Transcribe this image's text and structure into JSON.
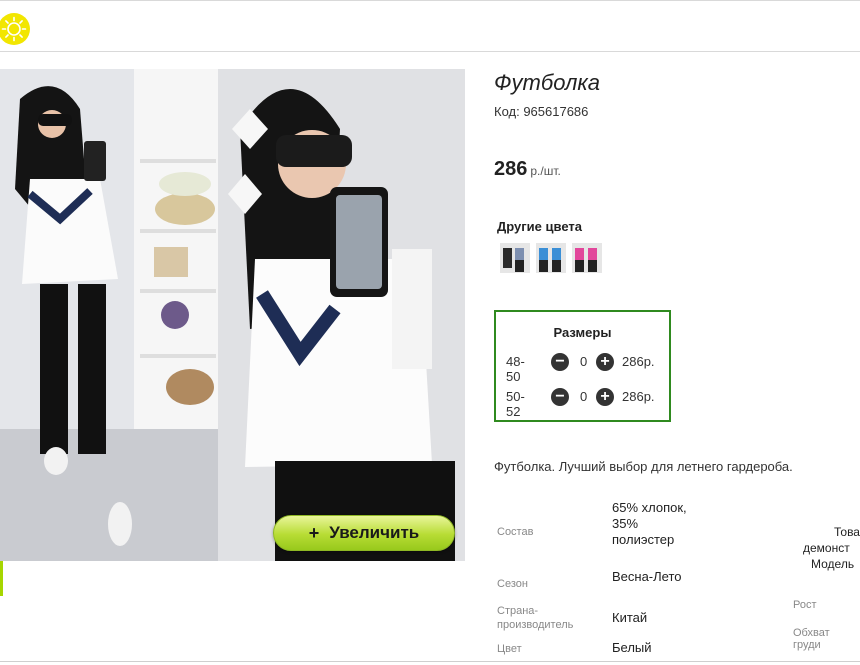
{
  "product": {
    "title": "Футболка",
    "code": "Код: 965617686",
    "price_value": "286",
    "price_unit": "р./шт.",
    "zoom_label": "Увеличить",
    "zoom_plus": "+",
    "other_colors_title": "Другие цвета",
    "sizes_title": "Размеры",
    "sizes": [
      {
        "label": "48-50",
        "qty": "0",
        "price": "286р."
      },
      {
        "label": "50-52",
        "qty": "0",
        "price": "286р."
      }
    ],
    "description": "Футболка. Лучший выбор для летнего гардероба.",
    "specs": [
      {
        "key": "Состав",
        "value": "65% хлопок, 35% полиэстер"
      },
      {
        "key": "Сезон",
        "value": "Весна-Лето"
      },
      {
        "key": "Страна-производитель",
        "value": "Китай"
      },
      {
        "key": "Цвет",
        "value": "Белый"
      }
    ],
    "right_text": [
      "Това",
      "демонст",
      "Модель"
    ],
    "right_specs": [
      "Рост",
      "Обхват груди"
    ]
  },
  "icons": {
    "logo": "sun-icon",
    "minus": "minus-icon",
    "plus": "plus-icon"
  },
  "colors": {
    "accent_green": "#2f8a1f",
    "button_green": "#b7dc34",
    "logo_yellow": "#f2e600"
  },
  "swatch_colors": [
    "#7d8fb0",
    "#3b8fd6",
    "#e2469b"
  ]
}
